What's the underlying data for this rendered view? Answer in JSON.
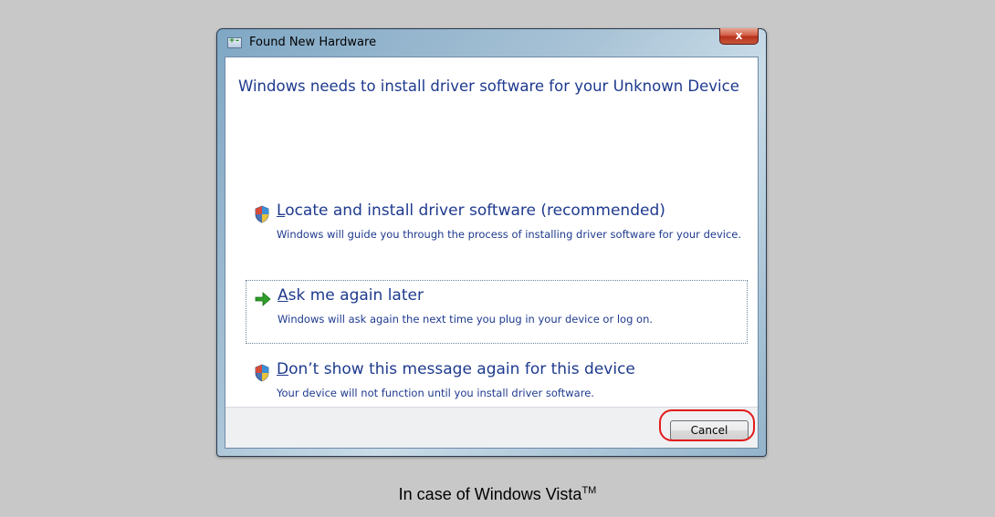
{
  "window": {
    "title": "Found New Hardware",
    "close_symbol": "x",
    "headline": "Windows needs to install driver software for your Unknown Device"
  },
  "options": [
    {
      "icon": "shield-icon",
      "accel": "L",
      "title_rest": "ocate and install driver software (recommended)",
      "description": "Windows will guide you through the process of installing driver software for your device."
    },
    {
      "icon": "arrow-right-icon",
      "accel": "A",
      "title_rest": "sk me again later",
      "description": "Windows will ask again the next time you plug in your device or log on."
    },
    {
      "icon": "shield-icon",
      "accel": "D",
      "title_rest": "on’t show this message again for this device",
      "description": "Your device will not function until you install driver software."
    }
  ],
  "footer": {
    "cancel_label": "Cancel"
  },
  "caption": {
    "text": "In case of Windows Vista",
    "superscript": "TM"
  },
  "colors": {
    "accent_text": "#1e3a8e",
    "highlight": "#e31b1b",
    "arrow_green": "#2e9e2a"
  }
}
